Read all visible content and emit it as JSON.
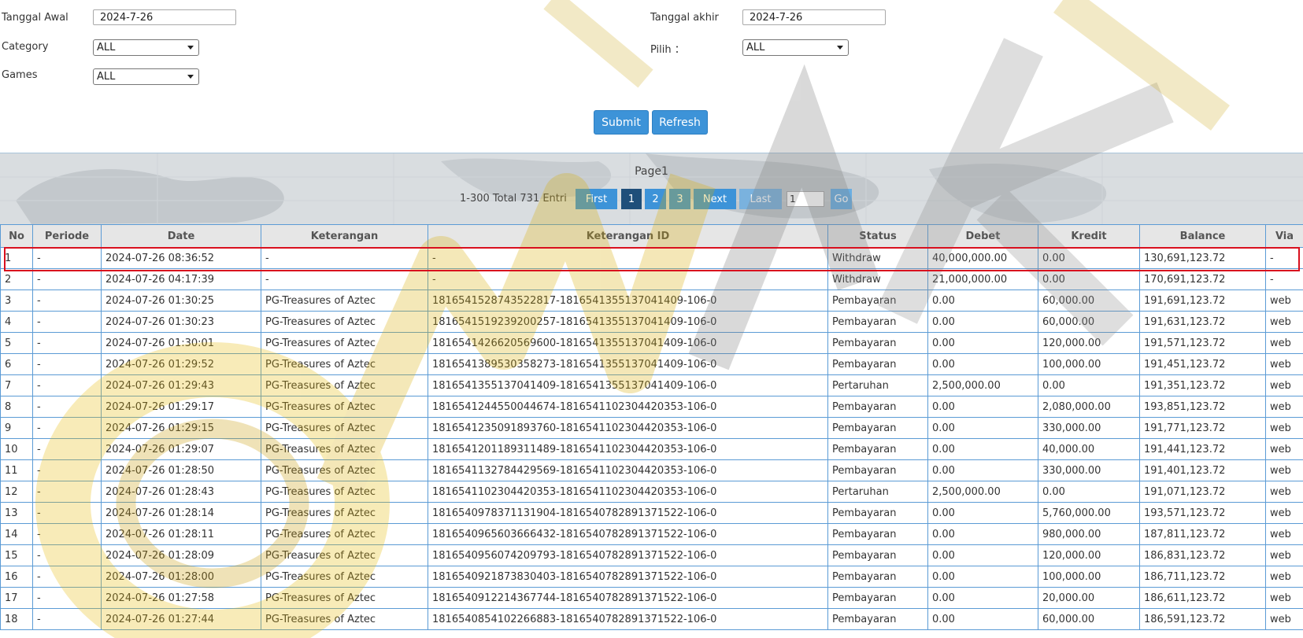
{
  "filters": {
    "tanggal_awal_label": "Tanggal Awal",
    "tanggal_awal_value": "2024-7-26",
    "tanggal_akhir_label": "Tanggal akhir",
    "tanggal_akhir_value": "2024-7-26",
    "category_label": "Category",
    "category_value": "ALL",
    "pilih_label": "Pilih ：",
    "pilih_value": "ALL",
    "games_label": "Games",
    "games_value": "ALL"
  },
  "actions": {
    "submit_label": "Submit",
    "refresh_label": "Refresh"
  },
  "pager": {
    "title": "Page1",
    "info": "1-300 Total 731 Entri",
    "first_label": "First",
    "pages": [
      "1",
      "2",
      "3"
    ],
    "next_label": "Next",
    "last_label": "Last",
    "go_input_value": "1",
    "go_label": "Go"
  },
  "table": {
    "columns": [
      "No",
      "Periode",
      "Date",
      "Keterangan",
      "Keterangan ID",
      "Status",
      "Debet",
      "Kredit",
      "Balance",
      "Via"
    ],
    "rows": [
      [
        "1",
        "-",
        "2024-07-26 08:36:52",
        "-",
        "-",
        "Withdraw",
        "40,000,000.00",
        "0.00",
        "130,691,123.72",
        "-"
      ],
      [
        "2",
        "-",
        "2024-07-26 04:17:39",
        "-",
        "-",
        "Withdraw",
        "21,000,000.00",
        "0.00",
        "170,691,123.72",
        "-"
      ],
      [
        "3",
        "-",
        "2024-07-26 01:30:25",
        "PG-Treasures of Aztec",
        "1816541528743522817-1816541355137041409-106-0",
        "Pembayaran",
        "0.00",
        "60,000.00",
        "191,691,123.72",
        "web"
      ],
      [
        "4",
        "-",
        "2024-07-26 01:30:23",
        "PG-Treasures of Aztec",
        "1816541519239200257-1816541355137041409-106-0",
        "Pembayaran",
        "0.00",
        "60,000.00",
        "191,631,123.72",
        "web"
      ],
      [
        "5",
        "-",
        "2024-07-26 01:30:01",
        "PG-Treasures of Aztec",
        "1816541426620569600-1816541355137041409-106-0",
        "Pembayaran",
        "0.00",
        "120,000.00",
        "191,571,123.72",
        "web"
      ],
      [
        "6",
        "-",
        "2024-07-26 01:29:52",
        "PG-Treasures of Aztec",
        "1816541389530358273-1816541355137041409-106-0",
        "Pembayaran",
        "0.00",
        "100,000.00",
        "191,451,123.72",
        "web"
      ],
      [
        "7",
        "-",
        "2024-07-26 01:29:43",
        "PG-Treasures of Aztec",
        "1816541355137041409-1816541355137041409-106-0",
        "Pertaruhan",
        "2,500,000.00",
        "0.00",
        "191,351,123.72",
        "web"
      ],
      [
        "8",
        "-",
        "2024-07-26 01:29:17",
        "PG-Treasures of Aztec",
        "1816541244550044674-1816541102304420353-106-0",
        "Pembayaran",
        "0.00",
        "2,080,000.00",
        "193,851,123.72",
        "web"
      ],
      [
        "9",
        "-",
        "2024-07-26 01:29:15",
        "PG-Treasures of Aztec",
        "1816541235091893760-1816541102304420353-106-0",
        "Pembayaran",
        "0.00",
        "330,000.00",
        "191,771,123.72",
        "web"
      ],
      [
        "10",
        "-",
        "2024-07-26 01:29:07",
        "PG-Treasures of Aztec",
        "1816541201189311489-1816541102304420353-106-0",
        "Pembayaran",
        "0.00",
        "40,000.00",
        "191,441,123.72",
        "web"
      ],
      [
        "11",
        "-",
        "2024-07-26 01:28:50",
        "PG-Treasures of Aztec",
        "1816541132784429569-1816541102304420353-106-0",
        "Pembayaran",
        "0.00",
        "330,000.00",
        "191,401,123.72",
        "web"
      ],
      [
        "12",
        "-",
        "2024-07-26 01:28:43",
        "PG-Treasures of Aztec",
        "1816541102304420353-1816541102304420353-106-0",
        "Pertaruhan",
        "2,500,000.00",
        "0.00",
        "191,071,123.72",
        "web"
      ],
      [
        "13",
        "-",
        "2024-07-26 01:28:14",
        "PG-Treasures of Aztec",
        "1816540978371131904-1816540782891371522-106-0",
        "Pembayaran",
        "0.00",
        "5,760,000.00",
        "193,571,123.72",
        "web"
      ],
      [
        "14",
        "-",
        "2024-07-26 01:28:11",
        "PG-Treasures of Aztec",
        "1816540965603666432-1816540782891371522-106-0",
        "Pembayaran",
        "0.00",
        "980,000.00",
        "187,811,123.72",
        "web"
      ],
      [
        "15",
        "-",
        "2024-07-26 01:28:09",
        "PG-Treasures of Aztec",
        "1816540956074209793-1816540782891371522-106-0",
        "Pembayaran",
        "0.00",
        "120,000.00",
        "186,831,123.72",
        "web"
      ],
      [
        "16",
        "-",
        "2024-07-26 01:28:00",
        "PG-Treasures of Aztec",
        "1816540921873830403-1816540782891371522-106-0",
        "Pembayaran",
        "0.00",
        "100,000.00",
        "186,711,123.72",
        "web"
      ],
      [
        "17",
        "-",
        "2024-07-26 01:27:58",
        "PG-Treasures of Aztec",
        "1816540912214367744-1816540782891371522-106-0",
        "Pembayaran",
        "0.00",
        "20,000.00",
        "186,611,123.72",
        "web"
      ],
      [
        "18",
        "-",
        "2024-07-26 01:27:44",
        "PG-Treasures of Aztec",
        "1816540854102266883-1816540782891371522-106-0",
        "Pembayaran",
        "0.00",
        "60,000.00",
        "186,591,123.72",
        "web"
      ]
    ],
    "red_rows": [
      0,
      1
    ]
  },
  "colors": {
    "button_blue": "#3d93d8",
    "active_page": "#1f4f7a",
    "link_blue": "#3a86c8",
    "negative_red": "#d9001b",
    "highlight_red": "#d9101e",
    "table_border": "#5b9bd5"
  }
}
